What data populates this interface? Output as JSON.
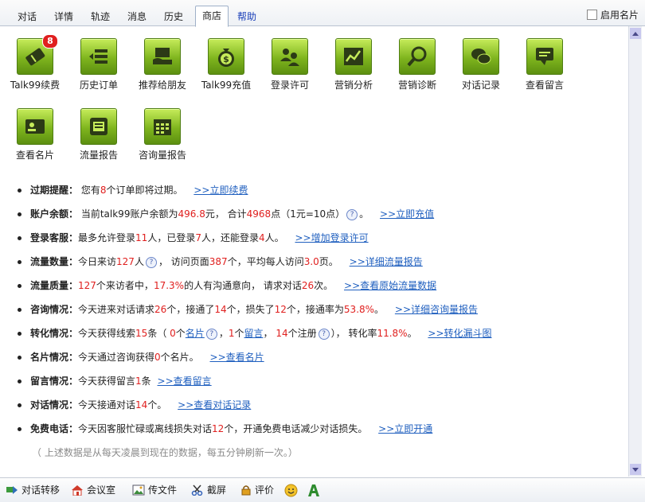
{
  "tabs": [
    {
      "label": "对话"
    },
    {
      "label": "详情"
    },
    {
      "label": "轨迹"
    },
    {
      "label": "消息"
    },
    {
      "label": "历史"
    },
    {
      "label": "商店"
    },
    {
      "label": "帮助"
    }
  ],
  "namecard_label": "启用名片",
  "tiles": [
    {
      "label": "Talk99续费",
      "badge": "8"
    },
    {
      "label": "历史订单"
    },
    {
      "label": "推荐给朋友"
    },
    {
      "label": "Talk99充值"
    },
    {
      "label": "登录许可"
    },
    {
      "label": "营销分析"
    },
    {
      "label": "营销诊断"
    },
    {
      "label": "对话记录"
    },
    {
      "label": "查看留言"
    },
    {
      "label": "查看名片"
    },
    {
      "label": "流量报告"
    },
    {
      "label": "咨询量报告"
    }
  ],
  "info": {
    "expire": {
      "title": "过期提醒：",
      "t1": "您有",
      "n1": "8",
      "t2": "个订单即将过期。",
      "link": ">>立即续费"
    },
    "balance": {
      "title": "账户余额：",
      "t1": "当前talk99账户余额为",
      "n1": "496.8",
      "t2": "元， 合计",
      "n2": "4968",
      "t3": "点（1元=10点）",
      "t4": "。",
      "link": ">>立即充值"
    },
    "login": {
      "title": "登录客服：",
      "t1": "最多允许登录",
      "n1": "11",
      "t2": "人，已登录",
      "n2": "7",
      "t3": "人，还能登录",
      "n3": "4",
      "t4": "人。",
      "link": ">>增加登录许可"
    },
    "traffic": {
      "title": "流量数量：",
      "t1": "今日来访",
      "n1": "127",
      "t2": "人",
      "t3": "， 访问页面",
      "n2": "387",
      "t4": "个，平均每人访问",
      "n3": "3.0",
      "t5": "页。",
      "link": ">>详细流量报告"
    },
    "quality": {
      "title": "流量质量：",
      "n1": "127",
      "t1": "个来访者中，",
      "n2": "17.3%",
      "t2": "的人有沟通意向， 请求对话",
      "n3": "26",
      "t3": "次。",
      "link": ">>查看原始流量数据"
    },
    "consult": {
      "title": "咨询情况：",
      "t1": "今天进来对话请求",
      "n1": "26",
      "t2": "个，接通了",
      "n2": "14",
      "t3": "个，损失了",
      "n3": "12",
      "t4": "个，接通率为",
      "n4": "53.8%",
      "t5": "。",
      "link": ">>详细咨询量报告"
    },
    "convert": {
      "title": "转化情况：",
      "t1": "今天获得线索",
      "n1": "15",
      "t2": "条（  ",
      "n2": "0",
      "t3": "个",
      "u1": "名片",
      "t4": "，",
      "n3": "1",
      "t5": "个",
      "u2": "留言",
      "t6": "，  ",
      "n4": "14",
      "t7": "个注册",
      "t8": "），  转化率",
      "n5": "11.8%",
      "t9": "。",
      "link": ">>转化漏斗图"
    },
    "card": {
      "title": "名片情况：",
      "t1": "今天通过咨询获得",
      "n1": "0",
      "t2": "个名片。",
      "link": ">>查看名片"
    },
    "message": {
      "title": "留言情况：",
      "t1": "今天获得留言",
      "n1": "1",
      "t2": "条",
      "link": ">>查看留言"
    },
    "dialog": {
      "title": "对话情况：",
      "t1": "今天接通对话",
      "n1": "14",
      "t2": "个。",
      "link": ">>查看对话记录"
    },
    "phone": {
      "title": "免费电话：",
      "t1": "今天因客服忙碌或离线损失对话",
      "n1": "12",
      "t2": "个，开通免费电话减少对话损失。",
      "link": ">>立即开通"
    }
  },
  "note": "（ 上述数据是从每天凌晨到现在的数据，每五分钟刷新一次。）",
  "bottom": [
    {
      "label": "对话转移"
    },
    {
      "label": "会议室"
    },
    {
      "label": "传文件"
    },
    {
      "label": "截屏"
    },
    {
      "label": "评价"
    }
  ],
  "colors": {
    "accent_red": "#e0201f",
    "link_blue": "#1f5fbf",
    "icon_green": "#7fb51e"
  }
}
